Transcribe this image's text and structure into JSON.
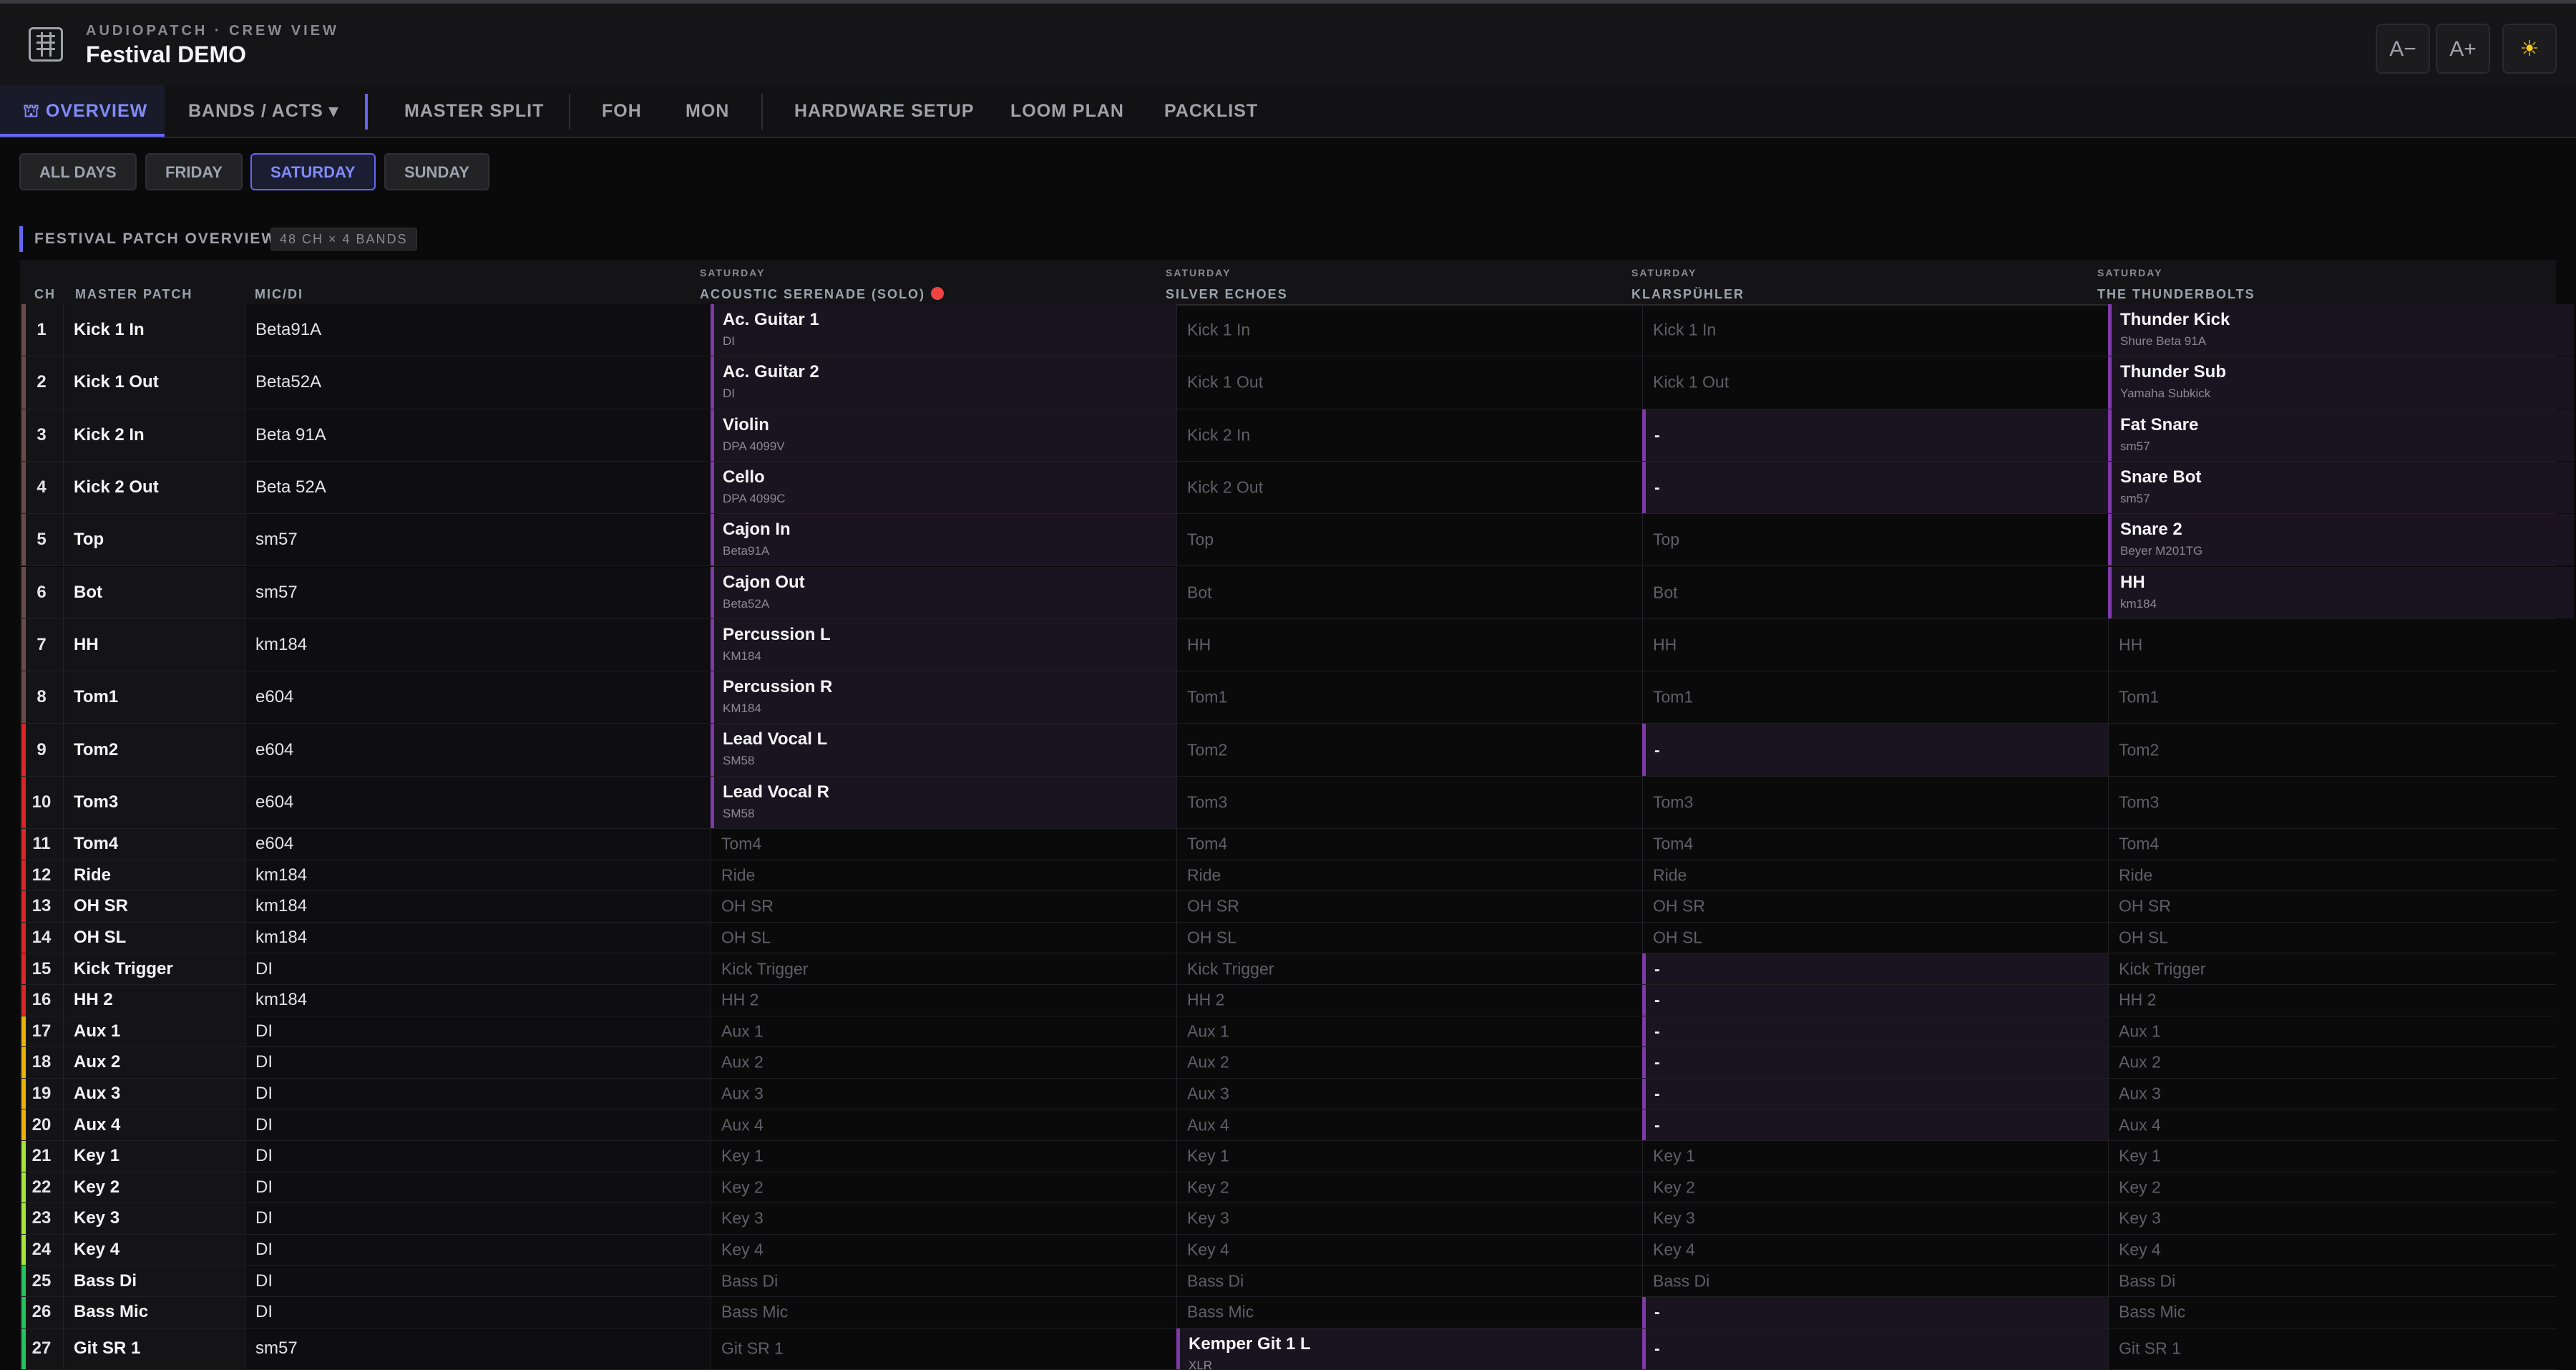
{
  "app": {
    "subtitle": "AUDIOPATCH · CREW VIEW",
    "title": "Festival DEMO"
  },
  "header_buttons": {
    "font_smaller": "A−",
    "font_larger": "A+",
    "theme": "☀"
  },
  "nav": {
    "overview": "⛫ OVERVIEW",
    "bands": "BANDS / ACTS ▾",
    "master_split": "MASTER SPLIT",
    "foh": "FOH",
    "mon": "MON",
    "hardware": "HARDWARE SETUP",
    "loom": "LOOM PLAN",
    "packlist": "PACKLIST"
  },
  "days": {
    "all": "ALL DAYS",
    "fri": "FRIDAY",
    "sat": "SATURDAY",
    "sun": "SUNDAY",
    "selected": "SATURDAY"
  },
  "section": {
    "title": "FESTIVAL PATCH OVERVIEW",
    "badge": "48 CH × 4 BANDS"
  },
  "columns": {
    "ch": "CH",
    "master": "MASTER PATCH",
    "mic": "MIC/DI"
  },
  "bands": [
    {
      "day": "SATURDAY",
      "name": "ACOUSTIC SERENADE (SOLO)"
    },
    {
      "day": "SATURDAY",
      "name": "SILVER ECHOES"
    },
    {
      "day": "SATURDAY",
      "name": "KLARSPÜHLER"
    },
    {
      "day": "SATURDAY",
      "name": "THE THUNDERBOLTS"
    }
  ],
  "rows": [
    {
      "ch": "1",
      "master": "Kick 1 In",
      "mic": "Beta91A",
      "b": [
        {
          "n": "Ac. Guitar 1",
          "s": "DI"
        },
        {
          "t": "Kick 1 In"
        },
        {
          "t": "Kick 1 In"
        },
        {
          "n": "Thunder Kick",
          "s": "Shure Beta 91A"
        }
      ]
    },
    {
      "ch": "2",
      "master": "Kick 1 Out",
      "mic": "Beta52A",
      "b": [
        {
          "n": "Ac. Guitar 2",
          "s": "DI"
        },
        {
          "t": "Kick 1 Out"
        },
        {
          "t": "Kick 1 Out"
        },
        {
          "n": "Thunder Sub",
          "s": "Yamaha Subkick"
        }
      ]
    },
    {
      "ch": "3",
      "master": "Kick 2 In",
      "mic": "Beta 91A",
      "b": [
        {
          "n": "Violin",
          "s": "DPA 4099V"
        },
        {
          "t": "Kick 2 In"
        },
        {
          "d": "-"
        },
        {
          "n": "Fat Snare",
          "s": "sm57"
        }
      ]
    },
    {
      "ch": "4",
      "master": "Kick 2 Out",
      "mic": "Beta 52A",
      "b": [
        {
          "n": "Cello",
          "s": "DPA 4099C"
        },
        {
          "t": "Kick 2 Out"
        },
        {
          "d": "-"
        },
        {
          "n": "Snare Bot",
          "s": "sm57"
        }
      ]
    },
    {
      "ch": "5",
      "master": "Top",
      "mic": "sm57",
      "b": [
        {
          "n": "Cajon In",
          "s": "Beta91A"
        },
        {
          "t": "Top"
        },
        {
          "t": "Top"
        },
        {
          "n": "Snare 2",
          "s": "Beyer M201TG"
        }
      ]
    },
    {
      "ch": "6",
      "master": "Bot",
      "mic": "sm57",
      "b": [
        {
          "n": "Cajon Out",
          "s": "Beta52A"
        },
        {
          "t": "Bot"
        },
        {
          "t": "Bot"
        },
        {
          "n": "HH",
          "s": "km184"
        }
      ]
    },
    {
      "ch": "7",
      "master": "HH",
      "mic": "km184",
      "b": [
        {
          "n": "Percussion L",
          "s": "KM184"
        },
        {
          "t": "HH"
        },
        {
          "t": "HH"
        },
        {
          "t": "HH"
        }
      ]
    },
    {
      "ch": "8",
      "master": "Tom1",
      "mic": "e604",
      "b": [
        {
          "n": "Percussion R",
          "s": "KM184"
        },
        {
          "t": "Tom1"
        },
        {
          "t": "Tom1"
        },
        {
          "t": "Tom1"
        }
      ]
    },
    {
      "ch": "9",
      "master": "Tom2",
      "mic": "e604",
      "b": [
        {
          "n": "Lead Vocal L",
          "s": "SM58"
        },
        {
          "t": "Tom2"
        },
        {
          "d": "-"
        },
        {
          "t": "Tom2"
        }
      ]
    },
    {
      "ch": "10",
      "master": "Tom3",
      "mic": "e604",
      "b": [
        {
          "n": "Lead Vocal R",
          "s": "SM58"
        },
        {
          "t": "Tom3"
        },
        {
          "t": "Tom3"
        },
        {
          "t": "Tom3"
        }
      ]
    },
    {
      "ch": "11",
      "master": "Tom4",
      "mic": "e604",
      "b": [
        {
          "t": "Tom4"
        },
        {
          "t": "Tom4"
        },
        {
          "t": "Tom4"
        },
        {
          "t": "Tom4"
        }
      ]
    },
    {
      "ch": "12",
      "master": "Ride",
      "mic": "km184",
      "b": [
        {
          "t": "Ride"
        },
        {
          "t": "Ride"
        },
        {
          "t": "Ride"
        },
        {
          "t": "Ride"
        }
      ]
    },
    {
      "ch": "13",
      "master": "OH SR",
      "mic": "km184",
      "b": [
        {
          "t": "OH SR"
        },
        {
          "t": "OH SR"
        },
        {
          "t": "OH SR"
        },
        {
          "t": "OH SR"
        }
      ]
    },
    {
      "ch": "14",
      "master": "OH SL",
      "mic": "km184",
      "b": [
        {
          "t": "OH SL"
        },
        {
          "t": "OH SL"
        },
        {
          "t": "OH SL"
        },
        {
          "t": "OH SL"
        }
      ]
    },
    {
      "ch": "15",
      "master": "Kick Trigger",
      "mic": "DI",
      "b": [
        {
          "t": "Kick Trigger"
        },
        {
          "t": "Kick Trigger"
        },
        {
          "d": "-"
        },
        {
          "t": "Kick Trigger"
        }
      ]
    },
    {
      "ch": "16",
      "master": "HH 2",
      "mic": "km184",
      "b": [
        {
          "t": "HH 2"
        },
        {
          "t": "HH 2"
        },
        {
          "d": "-"
        },
        {
          "t": "HH 2"
        }
      ]
    },
    {
      "ch": "17",
      "master": "Aux 1",
      "mic": "DI",
      "b": [
        {
          "t": "Aux 1"
        },
        {
          "t": "Aux 1"
        },
        {
          "d": "-"
        },
        {
          "t": "Aux 1"
        }
      ]
    },
    {
      "ch": "18",
      "master": "Aux 2",
      "mic": "DI",
      "b": [
        {
          "t": "Aux 2"
        },
        {
          "t": "Aux 2"
        },
        {
          "d": "-"
        },
        {
          "t": "Aux 2"
        }
      ]
    },
    {
      "ch": "19",
      "master": "Aux 3",
      "mic": "DI",
      "b": [
        {
          "t": "Aux 3"
        },
        {
          "t": "Aux 3"
        },
        {
          "d": "-"
        },
        {
          "t": "Aux 3"
        }
      ]
    },
    {
      "ch": "20",
      "master": "Aux 4",
      "mic": "DI",
      "b": [
        {
          "t": "Aux 4"
        },
        {
          "t": "Aux 4"
        },
        {
          "d": "-"
        },
        {
          "t": "Aux 4"
        }
      ]
    },
    {
      "ch": "21",
      "master": "Key 1",
      "mic": "DI",
      "b": [
        {
          "t": "Key 1"
        },
        {
          "t": "Key 1"
        },
        {
          "t": "Key 1"
        },
        {
          "t": "Key 1"
        }
      ]
    },
    {
      "ch": "22",
      "master": "Key 2",
      "mic": "DI",
      "b": [
        {
          "t": "Key 2"
        },
        {
          "t": "Key 2"
        },
        {
          "t": "Key 2"
        },
        {
          "t": "Key 2"
        }
      ]
    },
    {
      "ch": "23",
      "master": "Key 3",
      "mic": "DI",
      "b": [
        {
          "t": "Key 3"
        },
        {
          "t": "Key 3"
        },
        {
          "t": "Key 3"
        },
        {
          "t": "Key 3"
        }
      ]
    },
    {
      "ch": "24",
      "master": "Key 4",
      "mic": "DI",
      "b": [
        {
          "t": "Key 4"
        },
        {
          "t": "Key 4"
        },
        {
          "t": "Key 4"
        },
        {
          "t": "Key 4"
        }
      ]
    },
    {
      "ch": "25",
      "master": "Bass Di",
      "mic": "DI",
      "b": [
        {
          "t": "Bass Di"
        },
        {
          "t": "Bass Di"
        },
        {
          "t": "Bass Di"
        },
        {
          "t": "Bass Di"
        }
      ]
    },
    {
      "ch": "26",
      "master": "Bass Mic",
      "mic": "DI",
      "b": [
        {
          "t": "Bass Mic"
        },
        {
          "t": "Bass Mic"
        },
        {
          "d": "-"
        },
        {
          "t": "Bass Mic"
        }
      ]
    },
    {
      "ch": "27",
      "master": "Git SR 1",
      "mic": "sm57",
      "b": [
        {
          "t": "Git SR 1"
        },
        {
          "n": "Kemper Git 1 L",
          "s": "XLR"
        },
        {
          "d": "-"
        },
        {
          "t": "Git SR 1"
        }
      ]
    }
  ],
  "colors": {
    "accent": "#6366f1",
    "band_highlight": "#7e3aa8",
    "stripe_drums": "#6b4a4a",
    "stripe_toms": "#dc2626",
    "stripe_aux": "#eab308",
    "stripe_keys": "#a3e635",
    "stripe_bass": "#22c55e",
    "rec_dot": "#ef4444"
  }
}
